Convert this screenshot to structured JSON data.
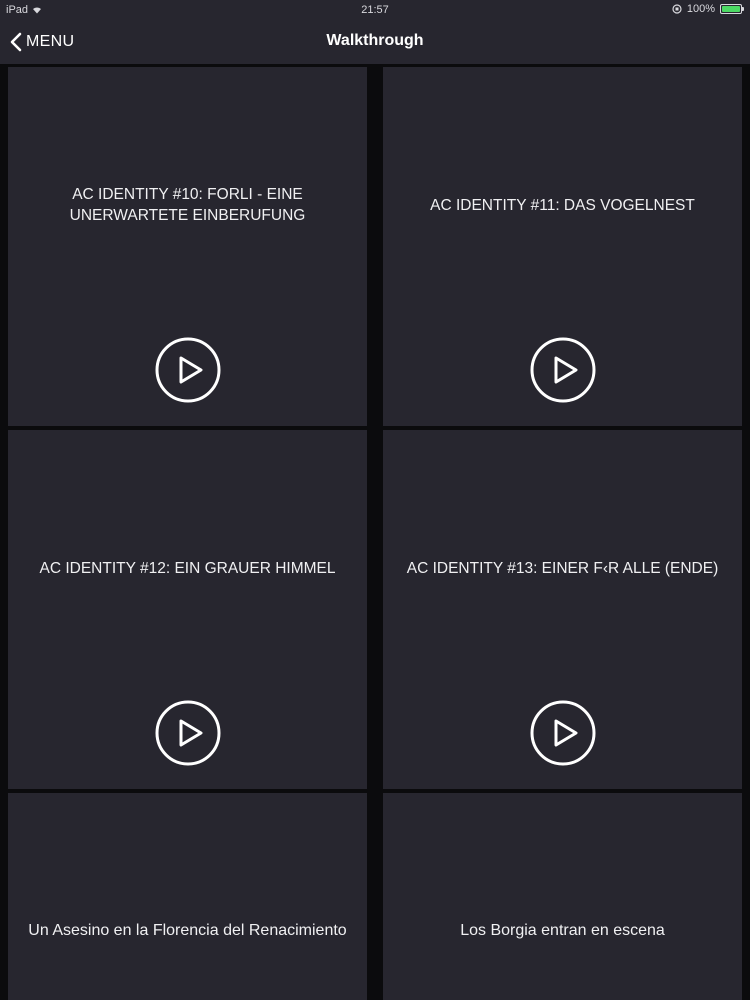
{
  "status_bar": {
    "device": "iPad",
    "time": "21:57",
    "battery": "100%",
    "battery_level": 1.0,
    "battery_color": "#4cd964"
  },
  "nav": {
    "back_label": "MENU",
    "back_icon": "chevron-left-icon",
    "title": "Walkthrough"
  },
  "tiles": [
    {
      "title": "AC IDENTITY #10: FORLI - EINE UNERWARTETE EINBERUFUNG",
      "icon": "play-circle-icon"
    },
    {
      "title": "AC IDENTITY #11: DAS VOGELNEST",
      "icon": "play-circle-icon"
    },
    {
      "title": "AC IDENTITY #12: EIN GRAUER HIMMEL",
      "icon": "play-circle-icon"
    },
    {
      "title": "AC IDENTITY #13: EINER F‹R ALLE (ENDE)",
      "icon": "play-circle-icon"
    },
    {
      "title": "Un Asesino en la Florencia del Renacimiento"
    },
    {
      "title": "Los Borgia entran en escena"
    }
  ],
  "colors": {
    "background": "#0b0b0d",
    "tile": "#27262f",
    "text": "#ffffff"
  }
}
